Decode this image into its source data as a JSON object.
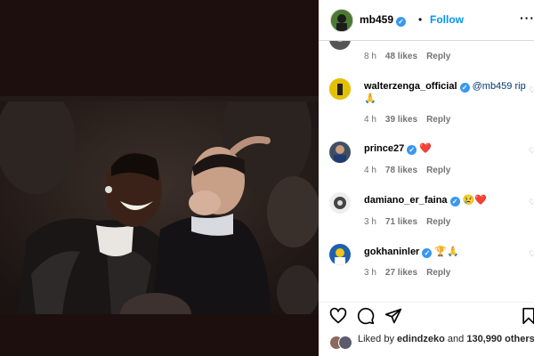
{
  "post": {
    "username": "mb459",
    "follow_label": "Follow",
    "separator": "•",
    "more_label": "···",
    "verified_mark": "✓"
  },
  "comments": [
    {
      "username": "",
      "text": "",
      "time": "8 h",
      "likes": "48 likes",
      "reply": "Reply"
    },
    {
      "username": "walterzenga_official",
      "text": "@mb459 rip 🙏",
      "time": "4 h",
      "likes": "39 likes",
      "reply": "Reply"
    },
    {
      "username": "prince27",
      "text": "❤️",
      "time": "4 h",
      "likes": "78 likes",
      "reply": "Reply"
    },
    {
      "username": "damiano_er_faina",
      "text": "😢❤️",
      "time": "3 h",
      "likes": "71 likes",
      "reply": "Reply"
    },
    {
      "username": "gokhaninler",
      "text": "🏆🙏",
      "time": "3 h",
      "likes": "27 likes",
      "reply": "Reply"
    }
  ],
  "liked_by": {
    "prefix": "Liked by",
    "user": "edindzeko",
    "conjunction": "and",
    "others": "130,990 others"
  },
  "icons": {
    "like": "heart-icon",
    "comment": "comment-icon",
    "share": "share-icon",
    "save": "bookmark-icon"
  },
  "colors": {
    "accent": "#0095f6",
    "verified": "#3897f0",
    "background_left": "#1e0f0f"
  }
}
